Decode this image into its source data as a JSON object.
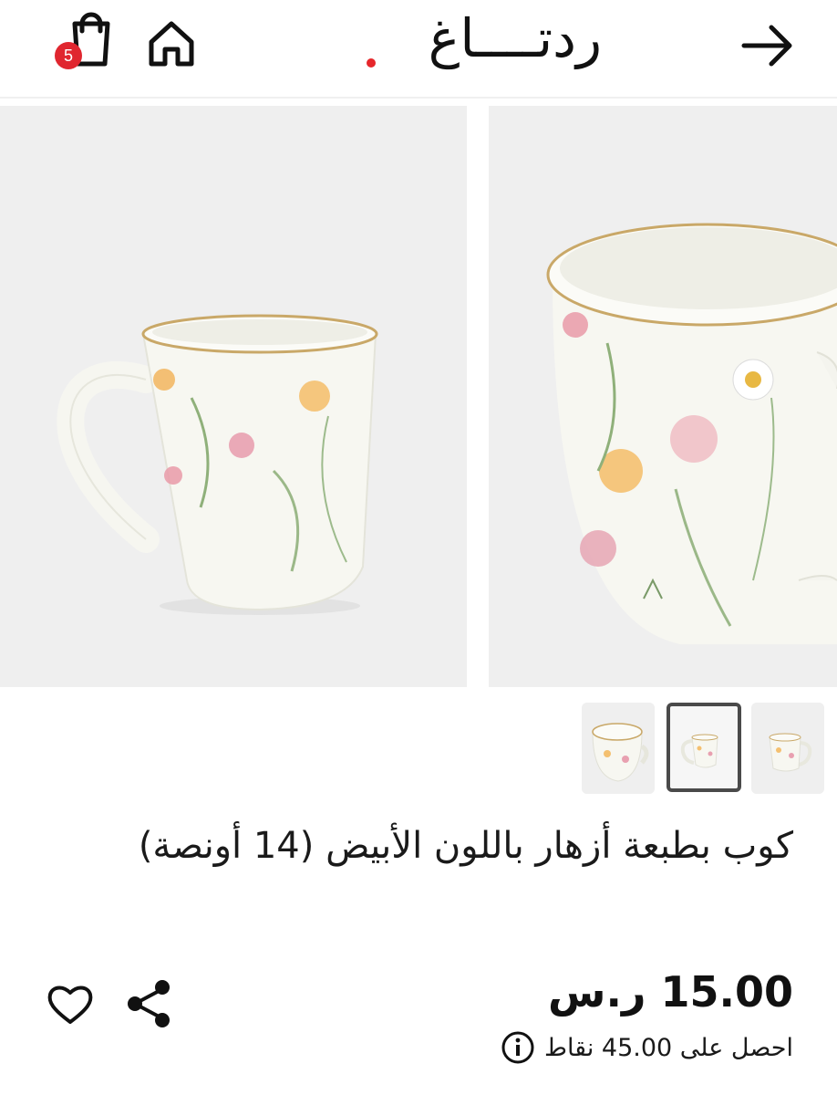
{
  "header": {
    "logo_text": "ردتــــاغ",
    "cart_count": "5"
  },
  "product": {
    "title": "كوب بطبعة أزهار باللون الأبيض (14 أونصة)",
    "price": "15.00 ر.س",
    "points_text": "احصل على 45.00 نقاط"
  },
  "colors": {
    "accent": "#e0262f",
    "image_bg": "#efefef",
    "text": "#1a1a1a"
  },
  "icons": [
    "arrow-right-icon",
    "home-icon",
    "shopping-bag-icon",
    "share-icon",
    "heart-icon",
    "info-icon"
  ]
}
